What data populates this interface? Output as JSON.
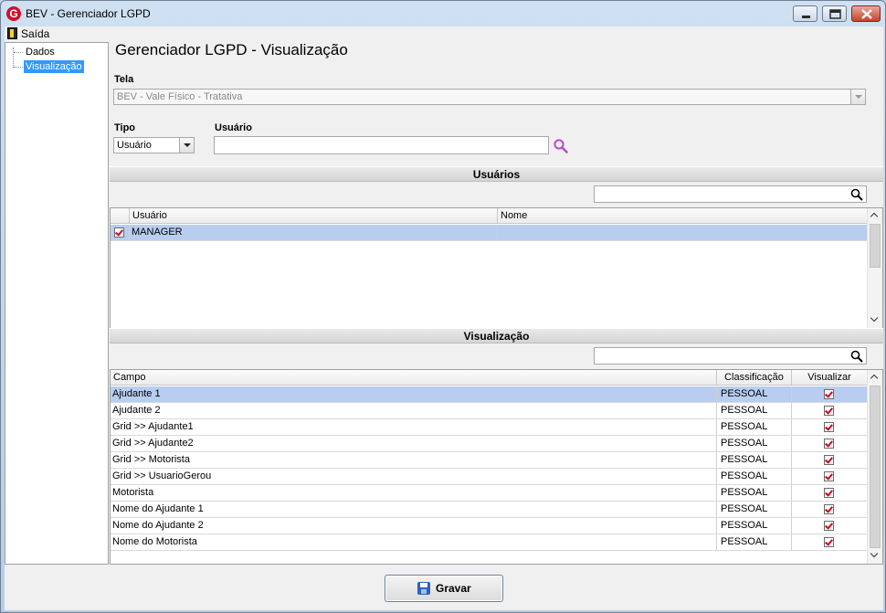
{
  "window": {
    "title": "BEV - Gerenciador LGPD",
    "app_logo": "G"
  },
  "menu": {
    "items": [
      {
        "label": "Saída",
        "icon": "exit-icon"
      }
    ]
  },
  "tree": {
    "items": [
      {
        "label": "Dados",
        "selected": false
      },
      {
        "label": "Visualização",
        "selected": true
      }
    ]
  },
  "page": {
    "title": "Gerenciador LGPD - Visualização"
  },
  "form": {
    "tela_label": "Tela",
    "tela_value": "BEV - Vale Físico - Tratativa",
    "tipo_label": "Tipo",
    "tipo_value": "Usuário",
    "usuario_label": "Usuário",
    "usuario_value": ""
  },
  "usuarios": {
    "header": "Usuários",
    "filter_value": "",
    "columns": [
      "Usuário",
      "Nome"
    ],
    "rows": [
      {
        "checked": true,
        "usuario": "MANAGER",
        "nome": ""
      }
    ]
  },
  "visualizacao": {
    "header": "Visualização",
    "filter_value": "",
    "columns": [
      "Campo",
      "Classificação",
      "Visualizar"
    ],
    "rows": [
      {
        "campo": "Ajudante 1",
        "classificacao": "PESSOAL",
        "visualizar": true
      },
      {
        "campo": "Ajudante 2",
        "classificacao": "PESSOAL",
        "visualizar": true
      },
      {
        "campo": "Grid >> Ajudante1",
        "classificacao": "PESSOAL",
        "visualizar": true
      },
      {
        "campo": "Grid >> Ajudante2",
        "classificacao": "PESSOAL",
        "visualizar": true
      },
      {
        "campo": "Grid >> Motorista",
        "classificacao": "PESSOAL",
        "visualizar": true
      },
      {
        "campo": "Grid >> UsuarioGerou",
        "classificacao": "PESSOAL",
        "visualizar": true
      },
      {
        "campo": "Motorista",
        "classificacao": "PESSOAL",
        "visualizar": true
      },
      {
        "campo": "Nome do Ajudante 1",
        "classificacao": "PESSOAL",
        "visualizar": true
      },
      {
        "campo": "Nome do Ajudante 2",
        "classificacao": "PESSOAL",
        "visualizar": true
      },
      {
        "campo": "Nome do Motorista",
        "classificacao": "PESSOAL",
        "visualizar": true
      }
    ]
  },
  "footer": {
    "save_label": "Gravar",
    "save_icon": "floppy-disk-icon"
  },
  "colors": {
    "selection": "#3399ff",
    "row_selected": "#b8cdef",
    "check": "#d0021b",
    "lookup_icon": "#b54fc9"
  }
}
